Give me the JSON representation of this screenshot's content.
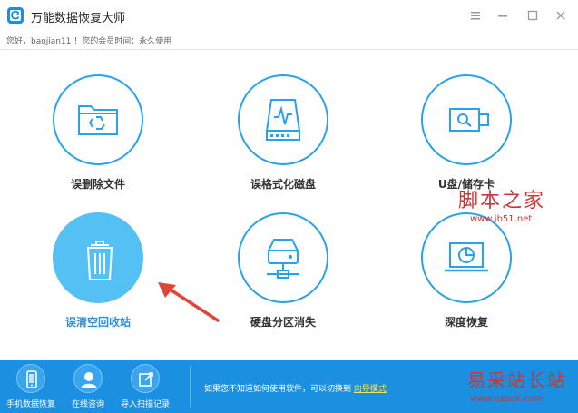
{
  "app": {
    "title": "万能数据恢复大师",
    "window_controls": [
      "menu-icon",
      "minimize-icon",
      "maximize-icon",
      "close-icon"
    ]
  },
  "infobar": {
    "text": "您好，baojian11 ！您的会员时间：永久使用"
  },
  "tiles": [
    {
      "label": "误删除文件",
      "icon": "folder-recycle-icon",
      "active": false
    },
    {
      "label": "误格式化磁盘",
      "icon": "disk-format-icon",
      "active": false
    },
    {
      "label": "U盘/储存卡",
      "icon": "usb-drive-icon",
      "active": false
    },
    {
      "label": "误清空回收站",
      "icon": "recycle-bin-icon",
      "active": true
    },
    {
      "label": "硬盘分区消失",
      "icon": "hard-drive-icon",
      "active": false
    },
    {
      "label": "深度恢复",
      "icon": "monitor-scan-icon",
      "active": false
    }
  ],
  "watermarks": {
    "top": "脚本之家",
    "top_url": "www.jb51.net",
    "bottom": "易采站长站",
    "bottom_url": "www.easck.com"
  },
  "bottombar": {
    "items": [
      {
        "label": "手机数据恢复",
        "icon": "phone-icon"
      },
      {
        "label": "在线咨询",
        "icon": "support-icon"
      },
      {
        "label": "导入扫描记录",
        "icon": "import-icon"
      }
    ],
    "hint": "如果您不知道如何使用软件，可以切换到",
    "hint_link": "向导模式"
  },
  "colors": {
    "accent": "#2aa2e8",
    "active_fill": "#54c1f4",
    "bottombar": "#1b8fe0",
    "arrow": "#e0443a"
  }
}
